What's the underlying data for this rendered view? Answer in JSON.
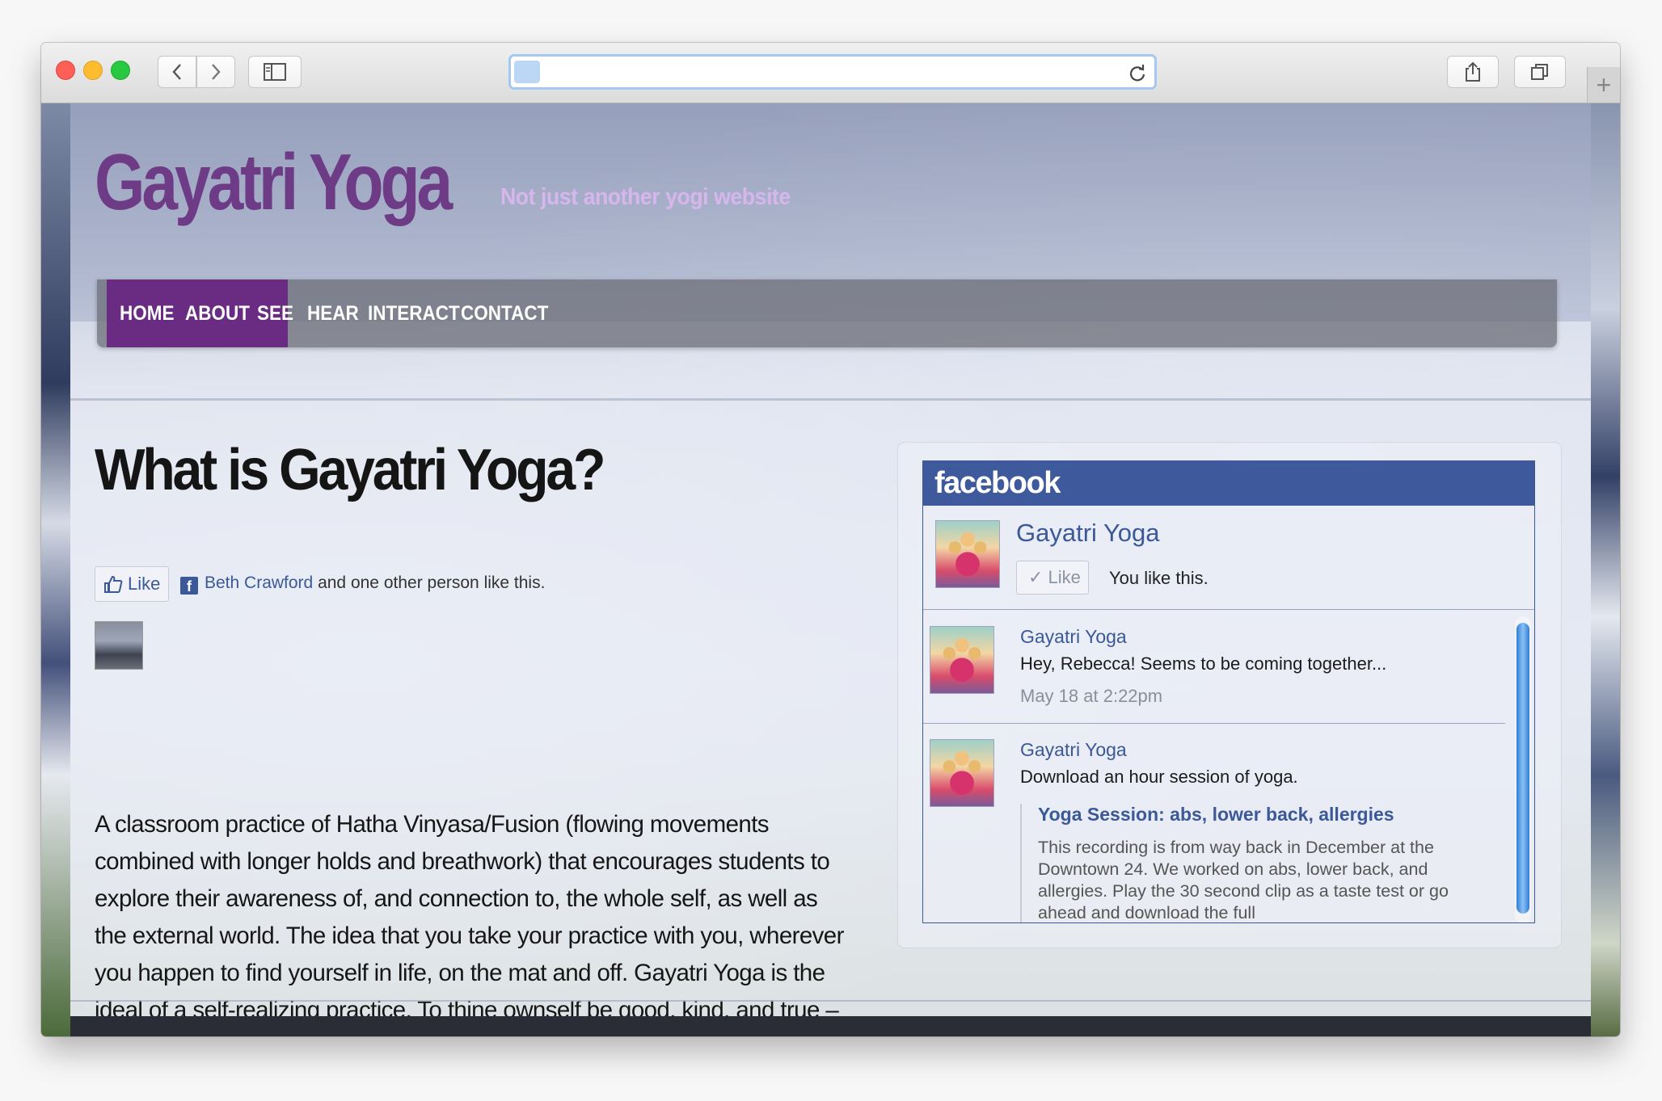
{
  "browser": {
    "address_text": "",
    "icons": [
      "back-icon",
      "forward-icon",
      "sidebar-icon",
      "reload-icon",
      "share-icon",
      "tabs-icon",
      "new-tab-icon"
    ]
  },
  "site": {
    "title": "Gayatri Yoga",
    "tagline": "Not just another yogi website",
    "colors": {
      "brand_purple": "#6a2c83",
      "tagline": "#d7b6ee",
      "facebook_blue": "#3b5998"
    }
  },
  "nav": {
    "items": [
      "HOME",
      "ABOUT",
      "SEE",
      "HEAR",
      "INTERACT",
      "CONTACT"
    ],
    "active": [
      "HOME",
      "ABOUT"
    ]
  },
  "article": {
    "heading": "What is Gayatri Yoga?",
    "like_label": "Like",
    "like_name": "Beth Crawford",
    "like_rest": "and one other person like this.",
    "body": "A classroom practice of Hatha Vinyasa/Fusion (flowing movements combined with longer holds and breathwork) that encourages students to explore their awareness of, and connection to, the whole self, as well as the external world. The idea that you take your practice with you, wherever you happen to find yourself in life, on the mat and off. Gayatri Yoga is the ideal of a self-realizing practice. To thine ownself be good, kind, and true – everything else will follow."
  },
  "facebook": {
    "brand": "facebook",
    "page_name": "Gayatri Yoga",
    "like_button": "Like",
    "you_like": "You like this.",
    "posts": [
      {
        "author": "Gayatri Yoga",
        "message": "Hey, Rebecca! Seems to be coming together...",
        "time": "May 18 at 2:22pm"
      },
      {
        "author": "Gayatri Yoga",
        "message": "Download an hour session of yoga.",
        "attachment_title": "Yoga Session: abs, lower back, allergies",
        "attachment_desc": "This recording is from way back in December at the Downtown 24.  We worked on abs, lower back, and allergies.  Play the 30 second clip as a taste test or go ahead and download the full"
      }
    ]
  }
}
